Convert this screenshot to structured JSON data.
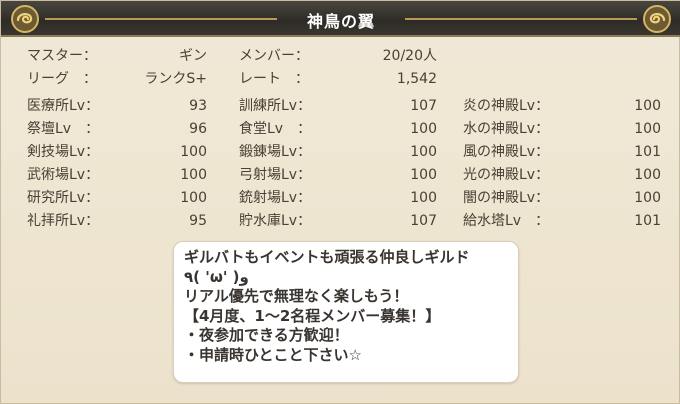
{
  "header": {
    "title": "神鳥の翼"
  },
  "guild_info": {
    "master_label": "マスター：",
    "master_value": "ギン",
    "members_label": "メンバー：",
    "members_value": "20/20人",
    "league_label": "リーグ　：",
    "league_value": "ランクS+",
    "rate_label": "レート　：",
    "rate_value": "1,542"
  },
  "facilities": {
    "col1": [
      {
        "label": "医療所Lv：",
        "value": "93"
      },
      {
        "label": "祭壇Lv　：",
        "value": "96"
      },
      {
        "label": "剣技場Lv：",
        "value": "100"
      },
      {
        "label": "武術場Lv：",
        "value": "100"
      },
      {
        "label": "研究所Lv：",
        "value": "100"
      },
      {
        "label": "礼拝所Lv：",
        "value": "95"
      }
    ],
    "col2": [
      {
        "label": "訓練所Lv：",
        "value": "107"
      },
      {
        "label": "食堂Lv　：",
        "value": "100"
      },
      {
        "label": "鍛錬場Lv：",
        "value": "100"
      },
      {
        "label": "弓射場Lv：",
        "value": "100"
      },
      {
        "label": "銃射場Lv：",
        "value": "100"
      },
      {
        "label": "貯水庫Lv：",
        "value": "107"
      }
    ],
    "col3": [
      {
        "label": "炎の神殿Lv：",
        "value": "100"
      },
      {
        "label": "水の神殿Lv：",
        "value": "100"
      },
      {
        "label": "風の神殿Lv：",
        "value": "101"
      },
      {
        "label": "光の神殿Lv：",
        "value": "100"
      },
      {
        "label": "闇の神殿Lv：",
        "value": "100"
      },
      {
        "label": "給水塔Lv　：",
        "value": "101"
      }
    ]
  },
  "comment": {
    "lines": [
      "ギルバトもイベントも頑張る仲良しギルド",
      "٩( 'ω' )و",
      "リアル優先で無理なく楽しもう！",
      "【4月度、1～2名程メンバー募集！】",
      "・夜参加できる方歓迎！",
      "・申請時ひとこと下さい☆"
    ]
  },
  "colors": {
    "title_bar": "#2e2b27",
    "background": "#efe6d2",
    "gold": "#b89a55",
    "text": "#4a4036"
  }
}
